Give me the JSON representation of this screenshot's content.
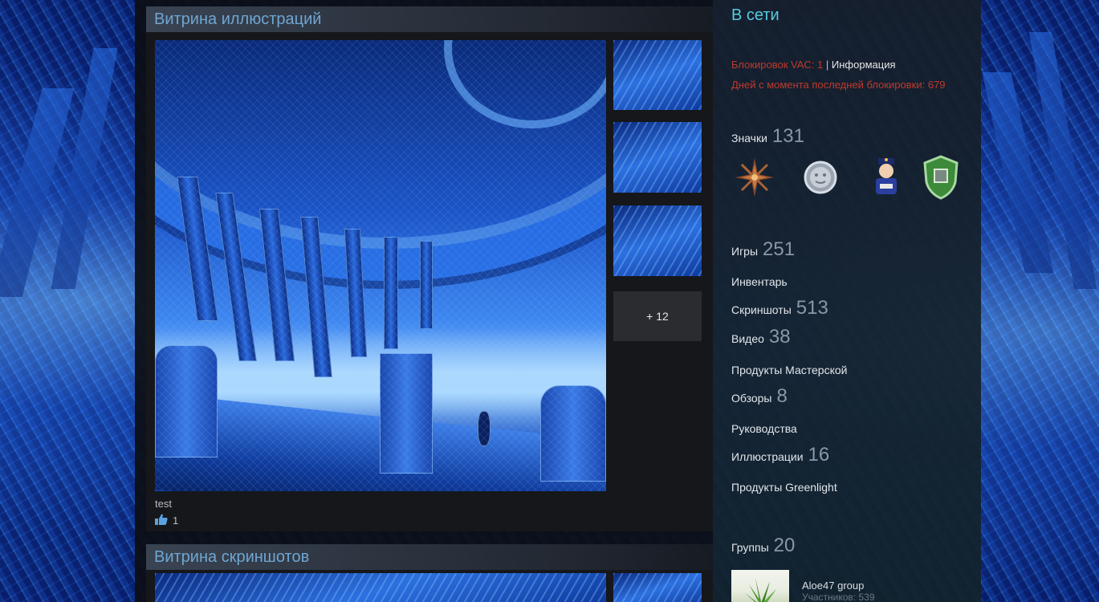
{
  "colors": {
    "accent_blue": "#6fa6d2",
    "online": "#57cbde",
    "vac_red": "#c0392b",
    "panel_dark": "#15171b"
  },
  "illustration_showcase": {
    "title": "Витрина иллюстраций",
    "more_label": "+ 12",
    "caption": "test",
    "likes": "1",
    "like_icon": "thumbs-up-icon"
  },
  "screenshot_showcase": {
    "title": "Витрина скриншотов"
  },
  "profile": {
    "status": "В сети",
    "vac_text": "Блокировок VAC: 1",
    "vac_separator": "|",
    "vac_info_link": "Информация",
    "vac_days": "Дней с момента последней блокировки: 679",
    "badges": {
      "label": "Значки",
      "count": "131",
      "icons": [
        "compass-star-badge-icon",
        "moon-badge-icon",
        "police-officer-badge-icon",
        "green-shield-badge-icon"
      ]
    },
    "games": {
      "label": "Игры",
      "count": "251"
    },
    "inventory": {
      "label": "Инвентарь"
    },
    "screenshots": {
      "label": "Скриншоты",
      "count": "513"
    },
    "videos": {
      "label": "Видео",
      "count": "38"
    },
    "workshop": {
      "label": "Продукты Мастерской"
    },
    "reviews": {
      "label": "Обзоры",
      "count": "8"
    },
    "guides": {
      "label": "Руководства"
    },
    "artwork": {
      "label": "Иллюстрации",
      "count": "16"
    },
    "greenlight": {
      "label": "Продукты Greenlight"
    },
    "groups": {
      "label": "Группы",
      "count": "20",
      "items": [
        {
          "name": "Aloe47 group",
          "members": "Участников: 539"
        }
      ]
    }
  }
}
